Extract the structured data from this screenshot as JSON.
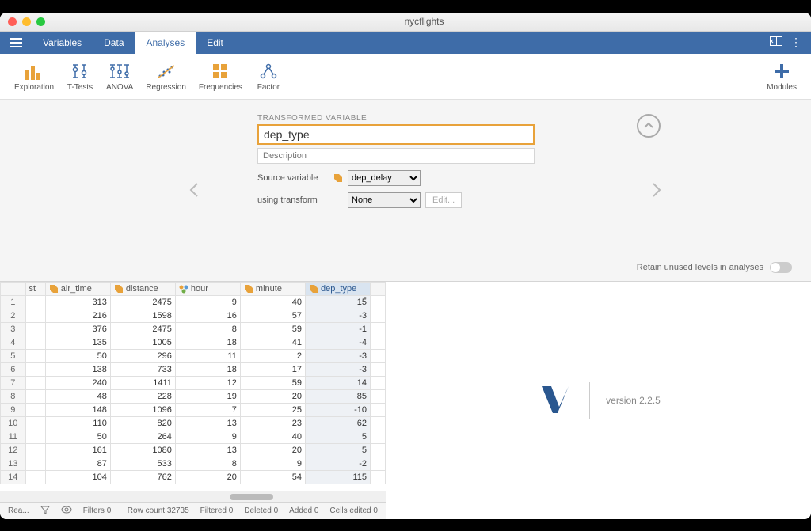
{
  "window": {
    "title": "nycflights"
  },
  "menu": {
    "variables": "Variables",
    "data": "Data",
    "analyses": "Analyses",
    "edit": "Edit"
  },
  "toolbar": {
    "exploration": "Exploration",
    "ttests": "T-Tests",
    "anova": "ANOVA",
    "regression": "Regression",
    "frequencies": "Frequencies",
    "factor": "Factor",
    "modules": "Modules"
  },
  "editor": {
    "header": "TRANSFORMED VARIABLE",
    "name": "dep_type",
    "desc_placeholder": "Description",
    "source_label": "Source variable",
    "source_value": "dep_delay",
    "transform_label": "using transform",
    "transform_value": "None",
    "edit_btn": "Edit...",
    "retain": "Retain unused levels in analyses"
  },
  "table": {
    "partial_col": "st",
    "columns": [
      "air_time",
      "distance",
      "hour",
      "minute",
      "dep_type"
    ],
    "active_col": "dep_type",
    "rows": [
      {
        "n": 1,
        "air_time": 313,
        "distance": 2475,
        "hour": 9,
        "minute": 40,
        "dep_type": 15
      },
      {
        "n": 2,
        "air_time": 216,
        "distance": 1598,
        "hour": 16,
        "minute": 57,
        "dep_type": -3
      },
      {
        "n": 3,
        "air_time": 376,
        "distance": 2475,
        "hour": 8,
        "minute": 59,
        "dep_type": -1
      },
      {
        "n": 4,
        "air_time": 135,
        "distance": 1005,
        "hour": 18,
        "minute": 41,
        "dep_type": -4
      },
      {
        "n": 5,
        "air_time": 50,
        "distance": 296,
        "hour": 11,
        "minute": 2,
        "dep_type": -3
      },
      {
        "n": 6,
        "air_time": 138,
        "distance": 733,
        "hour": 18,
        "minute": 17,
        "dep_type": -3
      },
      {
        "n": 7,
        "air_time": 240,
        "distance": 1411,
        "hour": 12,
        "minute": 59,
        "dep_type": 14
      },
      {
        "n": 8,
        "air_time": 48,
        "distance": 228,
        "hour": 19,
        "minute": 20,
        "dep_type": 85
      },
      {
        "n": 9,
        "air_time": 148,
        "distance": 1096,
        "hour": 7,
        "minute": 25,
        "dep_type": -10
      },
      {
        "n": 10,
        "air_time": 110,
        "distance": 820,
        "hour": 13,
        "minute": 23,
        "dep_type": 62
      },
      {
        "n": 11,
        "air_time": 50,
        "distance": 264,
        "hour": 9,
        "minute": 40,
        "dep_type": 5
      },
      {
        "n": 12,
        "air_time": 161,
        "distance": 1080,
        "hour": 13,
        "minute": 20,
        "dep_type": 5
      },
      {
        "n": 13,
        "air_time": 87,
        "distance": 533,
        "hour": 8,
        "minute": 9,
        "dep_type": -2
      },
      {
        "n": 14,
        "air_time": 104,
        "distance": 762,
        "hour": 20,
        "minute": 54,
        "dep_type": 115
      }
    ]
  },
  "status": {
    "ready": "Rea...",
    "filters": "Filters 0",
    "rowcount": "Row count 32735",
    "filtered": "Filtered 0",
    "deleted": "Deleted 0",
    "added": "Added 0",
    "edited": "Cells edited 0"
  },
  "results": {
    "version": "version 2.2.5"
  }
}
